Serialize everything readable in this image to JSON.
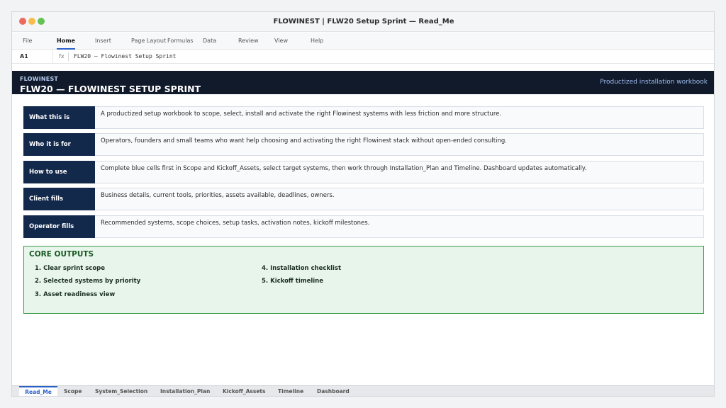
{
  "window": {
    "title": "FLOWINEST | FLW20 Setup Sprint — Read_Me"
  },
  "ribbon": {
    "tabs": [
      {
        "label": "File"
      },
      {
        "label": "Home",
        "active": true
      },
      {
        "label": "Insert"
      },
      {
        "label": "Page Layout"
      },
      {
        "label": "Formulas"
      },
      {
        "label": "Data"
      },
      {
        "label": "Review"
      },
      {
        "label": "View"
      },
      {
        "label": "Help"
      }
    ]
  },
  "formula_bar": {
    "cell_ref": "A1",
    "fx": "fx",
    "content": "FLW20 — Flowinest Setup Sprint"
  },
  "banner": {
    "brand": "FLOWINEST",
    "title": "FLW20 — FLOWINEST SETUP SPRINT",
    "subtitle": "Productized installation workbook"
  },
  "info_rows": [
    {
      "label": "What this is",
      "value": "A productized setup workbook to scope, select, install and activate the right Flowinest systems with less friction and more structure."
    },
    {
      "label": "Who it is for",
      "value": "Operators, founders and small teams who want help choosing and activating the right Flowinest stack without open-ended consulting."
    },
    {
      "label": "How to use",
      "value": "Complete blue cells first in Scope and Kickoff_Assets, select target systems, then work through Installation_Plan and Timeline. Dashboard updates automatically."
    },
    {
      "label": "Client fills",
      "value": "Business details, current tools, priorities, assets available, deadlines, owners."
    },
    {
      "label": "Operator fills",
      "value": "Recommended systems, scope choices, setup tasks, activation notes, kickoff milestones."
    }
  ],
  "core_outputs": {
    "title": "CORE OUTPUTS",
    "items": [
      "1. Clear sprint scope",
      "2. Selected systems by priority",
      "3. Asset readiness view",
      "4. Installation checklist",
      "5. Kickoff timeline"
    ]
  },
  "sheet_tabs": [
    {
      "label": "Read_Me",
      "active": true
    },
    {
      "label": "Scope"
    },
    {
      "label": "System_Selection"
    },
    {
      "label": "Installation_Plan"
    },
    {
      "label": "Kickoff_Assets"
    },
    {
      "label": "Timeline"
    },
    {
      "label": "Dashboard"
    }
  ],
  "colors": {
    "banner_bg": "#111a2b",
    "label_bg": "#13294b",
    "accent_blue": "#2b61c7",
    "outputs_bg": "#e8f5ea",
    "outputs_border": "#3a9a4a"
  }
}
